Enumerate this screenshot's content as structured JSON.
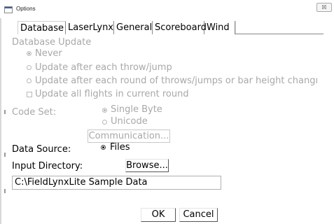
{
  "window": {
    "title": "Options",
    "close_glyph": "☒"
  },
  "tabs": [
    {
      "label": "Database"
    },
    {
      "label": "LaserLynx"
    },
    {
      "label": "General"
    },
    {
      "label": "Scoreboard"
    },
    {
      "label": "Wind"
    }
  ],
  "database_update": {
    "heading": "Database Update",
    "options": [
      {
        "label": "Never",
        "selected": true
      },
      {
        "label": "Update after each throw/jump",
        "selected": false
      },
      {
        "label": "Update after each round of throws/jumps or bar height changı",
        "selected": false
      }
    ],
    "checkbox_label": "Update all flights in current round"
  },
  "code_set": {
    "label": "Code Set:",
    "options": [
      {
        "label": "Single Byte",
        "selected": true
      },
      {
        "label": "Unicode",
        "selected": false
      }
    ],
    "communication_button": "Communication..."
  },
  "data_source": {
    "label": "Data Source:",
    "option_label": "Files",
    "selected": true
  },
  "input_directory": {
    "label": "Input Directory:",
    "browse_button": "Browse...",
    "value": "C:\\FieldLynxLite Sample Data"
  },
  "footer": {
    "ok_button": "OK",
    "cancel_button": "Cancel"
  }
}
